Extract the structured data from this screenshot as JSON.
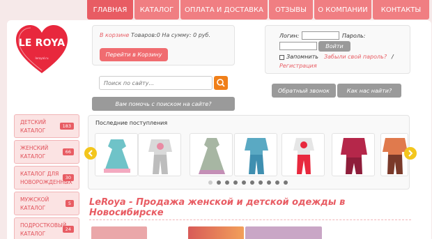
{
  "nav": {
    "items": [
      {
        "label": "ГЛАВНАЯ",
        "active": true
      },
      {
        "label": "КАТАЛОГ",
        "active": false
      },
      {
        "label": "ОПЛАТА И ДОСТАВКА",
        "active": false
      },
      {
        "label": "ОТЗЫВЫ",
        "active": false
      },
      {
        "label": "О КОМПАНИИ",
        "active": false
      },
      {
        "label": "КОНТАКТЫ",
        "active": false
      }
    ]
  },
  "logo": {
    "text": "LE ROYA",
    "subtext": "leroyal.ru"
  },
  "cart": {
    "prefix": "В корзине",
    "items_label": "Товаров:",
    "items_count": "0",
    "sum_label": "На сумму:",
    "sum_value": "0 руб.",
    "go_button": "Перейти в Корзину"
  },
  "search": {
    "placeholder": "Поиск по сайту...",
    "help_button": "Вам помочь с поиском на сайте?"
  },
  "login": {
    "login_label": "Логин:",
    "password_label": "Пароль:",
    "submit": "Войти",
    "remember": "Запомнить",
    "forgot": "Забыли свой пароль?",
    "separator": "/",
    "register": "Регистрация",
    "callback": "Обратный звонок",
    "how_to_find": "Как нас найти?"
  },
  "categories": [
    {
      "label": "Детский каталог",
      "count": "183"
    },
    {
      "label": "Женский каталог",
      "count": "66"
    },
    {
      "label": "Каталог для новорожденных",
      "count": "30"
    },
    {
      "label": "Мужской каталог",
      "count": "5"
    },
    {
      "label": "Подростковый каталог",
      "count": "24"
    }
  ],
  "new_arrivals": {
    "title": "Последние поступления"
  },
  "main": {
    "heading": "LeRoya - Продажа женской и детской одежды в Новосибирске"
  },
  "colors": {
    "accent": "#e85c63",
    "nav": "#f07e82",
    "search_button": "#f07f19",
    "arrow": "#f3c61d",
    "grey_button": "#9a9a9a"
  }
}
